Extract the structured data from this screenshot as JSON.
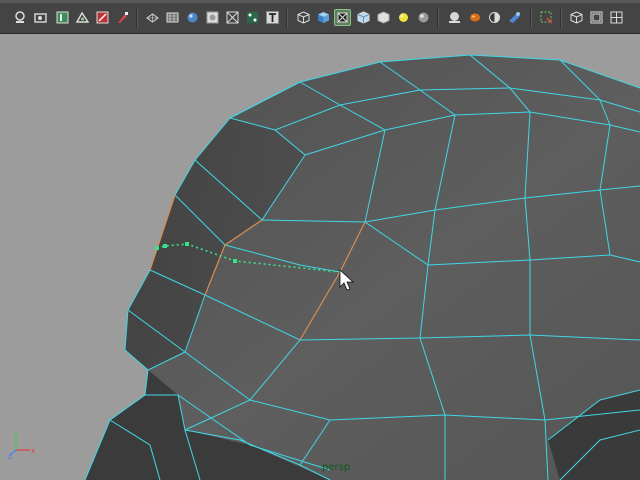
{
  "viewport": {
    "camera_label": "persp",
    "background_color": "#9c9c9c",
    "wireframe_color": "#3fd7e6",
    "selection_color": "#d9884a",
    "cut_line_color": "#39e28a"
  },
  "toolbar": {
    "items": [
      {
        "name": "render-view-icon"
      },
      {
        "name": "render-frame-icon"
      },
      {
        "name": "ipr-render-icon"
      },
      {
        "name": "render-settings-icon"
      },
      {
        "name": "hypershade-icon"
      },
      {
        "name": "paint-icon"
      },
      {
        "name": "wireframe-shading-icon"
      },
      {
        "name": "smooth-shading-icon"
      },
      {
        "name": "texture-icon"
      },
      {
        "name": "lights-icon"
      },
      {
        "name": "shadows-icon"
      },
      {
        "name": "text-icon"
      },
      {
        "name": "cube-wire-icon"
      },
      {
        "name": "cube-shaded-icon"
      },
      {
        "name": "isolate-icon"
      },
      {
        "name": "textured-cube-icon"
      },
      {
        "name": "light-bulb-icon"
      },
      {
        "name": "sphere-icon"
      },
      {
        "name": "ambient-occlusion-icon"
      },
      {
        "name": "motion-blur-icon"
      },
      {
        "name": "anti-alias-icon"
      },
      {
        "name": "depth-of-field-icon"
      },
      {
        "name": "select-region-icon"
      },
      {
        "name": "x-ray-icon"
      },
      {
        "name": "layout-icon"
      },
      {
        "name": "maximize-icon"
      }
    ]
  }
}
